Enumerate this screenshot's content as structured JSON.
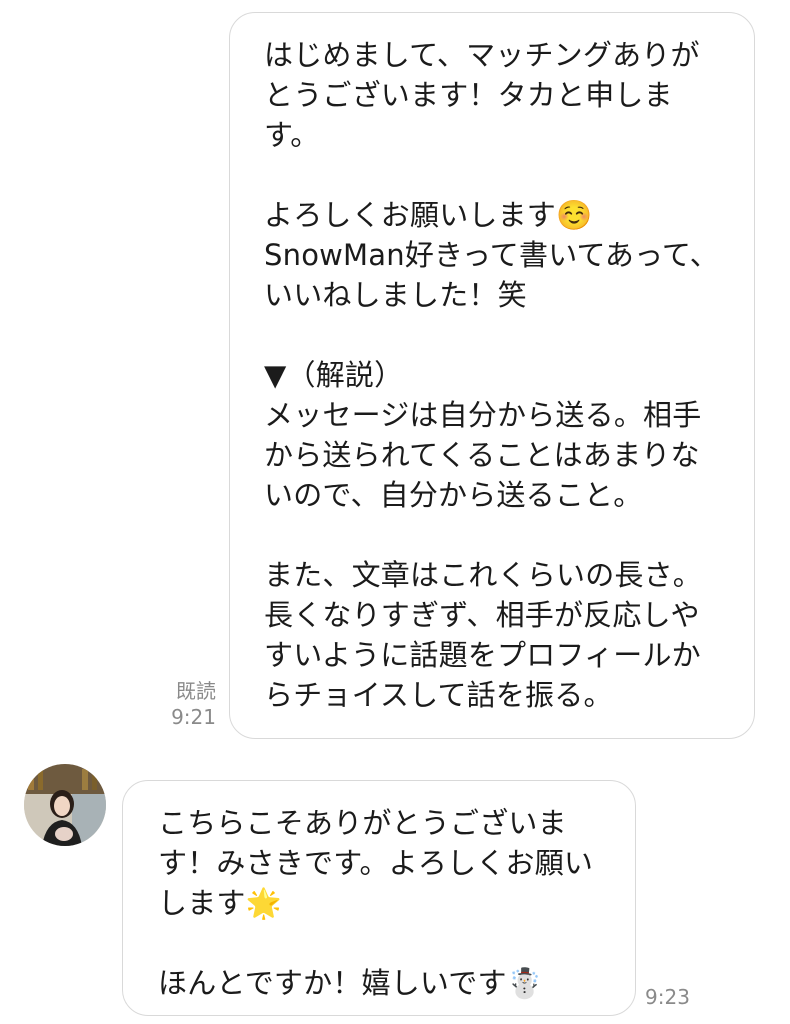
{
  "conversation": {
    "sent_message": {
      "lines": [
        "はじめまして、マッチングありが",
        "とうございます！タカと申しま",
        "す。",
        "",
        "よろしくお願いします☺️",
        "SnowMan好きって書いてあって、",
        "いいねしました！笑",
        "",
        "▼（解説）",
        "メッセージは自分から送る。相手",
        "から送られてくることはあまりな",
        "いので、自分から送ること。",
        "",
        "また、文章はこれくらいの長さ。",
        "長くなりすぎず、相手が反応しや",
        "すいように話題をプロフィールか",
        "らチョイスして話を振る。"
      ],
      "read_label": "既読",
      "time": "9:21"
    },
    "received_message": {
      "lines": [
        "こちらこそありがとうございま",
        "す！みさきです。よろしくお願い",
        "します🌟",
        "",
        "ほんとですか！嬉しいです☃️"
      ],
      "time": "9:23",
      "avatar_icon": "user-avatar-photo"
    }
  }
}
